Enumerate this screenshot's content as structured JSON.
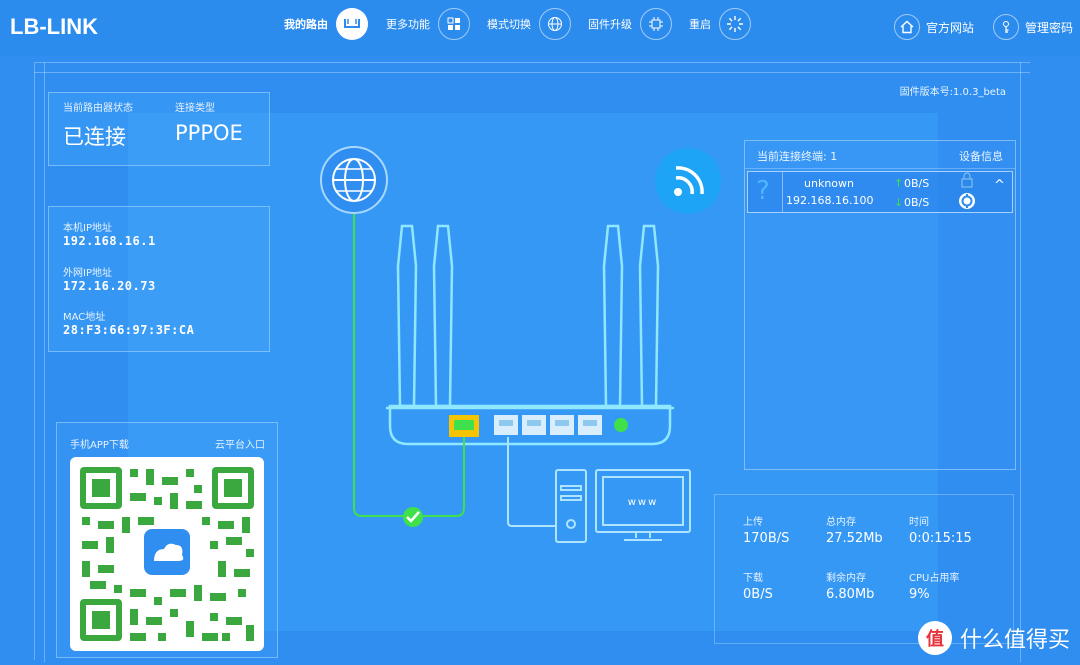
{
  "brand": {
    "logo_text": "LB-LINK"
  },
  "nav": {
    "items": [
      {
        "label": "我的路由",
        "icon": "router-icon",
        "active": true
      },
      {
        "label": "更多功能",
        "icon": "grid-icon",
        "active": false
      },
      {
        "label": "模式切换",
        "icon": "globe-icon",
        "active": false
      },
      {
        "label": "固件升级",
        "icon": "chip-icon",
        "active": false
      },
      {
        "label": "重启",
        "icon": "restart-icon",
        "active": false
      }
    ],
    "right": [
      {
        "label": "官方网站",
        "icon": "home-icon"
      },
      {
        "label": "管理密码",
        "icon": "key-icon"
      }
    ]
  },
  "firmware": "固件版本号:1.0.3_beta",
  "status": {
    "state_label": "当前路由器状态",
    "state_value": "已连接",
    "type_label": "连接类型",
    "type_value": "PPPOE"
  },
  "network": {
    "local_ip_label": "本机IP地址",
    "local_ip": "192.168.16.1",
    "wan_ip_label": "外网IP地址",
    "wan_ip": "172.16.20.73",
    "mac_label": "MAC地址",
    "mac": "28:F3:66:97:3F:CA"
  },
  "app": {
    "download_label": "手机APP下载",
    "cloud_label": "云平台入口"
  },
  "devices": {
    "header_label": "当前连接终端: 1",
    "info_label": "设备信息",
    "rows": [
      {
        "name": "unknown",
        "ip": "192.168.16.100",
        "up": "0B/S",
        "down": "0B/S"
      }
    ]
  },
  "diagram": {
    "pc_screen_text": "www"
  },
  "stats": {
    "upload_label": "上传",
    "upload": "170B/S",
    "total_mem_label": "总内存",
    "total_mem": "27.52Mb",
    "time_label": "时间",
    "time": "0:0:15:15",
    "download_label": "下载",
    "download": "0B/S",
    "free_mem_label": "剩余内存",
    "free_mem": "6.80Mb",
    "cpu_label": "CPU占用率",
    "cpu": "9%"
  },
  "watermark": {
    "text": "什么值得买",
    "logo_char": "值"
  },
  "colors": {
    "accent_green": "#3ee04c",
    "port_yellow": "#f5c400",
    "bg_blue": "#2f8ef0"
  }
}
